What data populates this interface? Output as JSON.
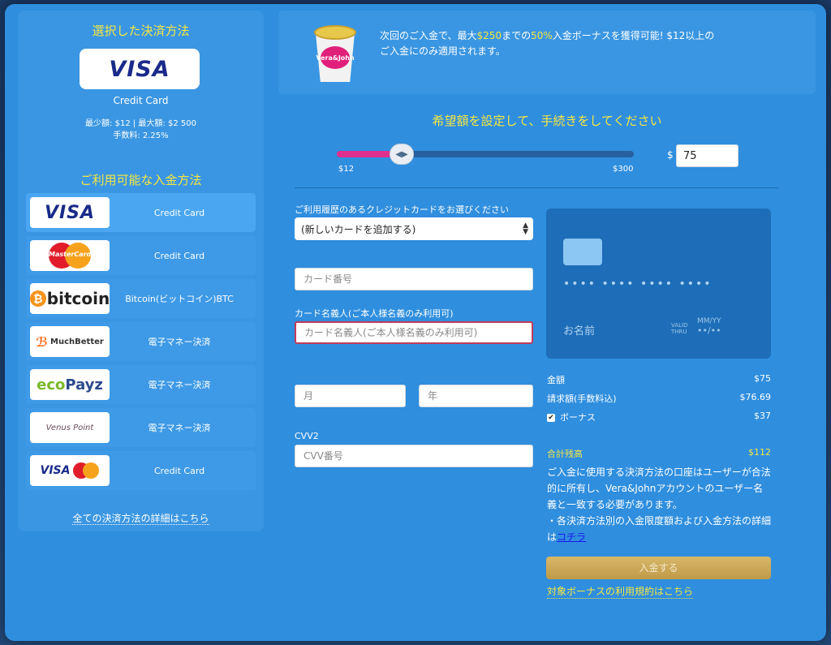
{
  "close": "×",
  "selected": {
    "title": "選択した決済方法",
    "logo": "VISA",
    "name": "Credit Card",
    "limits": "最少額: $12 | 最大額: $2 500",
    "fee": "手数料: 2.25%"
  },
  "available": {
    "title": "ご利用可能な入金方法",
    "methods": [
      {
        "logo": "VISA",
        "label": "Credit Card",
        "active": true
      },
      {
        "logo": "MasterCard",
        "label": "Credit Card"
      },
      {
        "logo": "bitcoin",
        "label": "Bitcoin(ビットコイン)BTC"
      },
      {
        "logo": "MuchBetter",
        "label": "電子マネー決済"
      },
      {
        "logo": "ecoPayz",
        "label": "電子マネー決済"
      },
      {
        "logo": "Venus Point",
        "label": "電子マネー決済"
      },
      {
        "logo": "VISA",
        "label": "Credit Card"
      }
    ],
    "all_link": "全ての決済方法の詳細はこちら"
  },
  "promo": {
    "cup_brand": "Vera&John",
    "line1_a": "次回のご入金で、最大",
    "line1_b": "$250",
    "line1_c": "までの",
    "line1_d": "50%",
    "line1_e": "入金ボーナスを獲得可能! $12以上の",
    "line2": "ご入金にのみ適用されます。"
  },
  "amount": {
    "title": "希望額を設定して、手続きをしてください",
    "min_label": "$12",
    "max_label": "$300",
    "min": 12,
    "max": 300,
    "value": 75,
    "currency": "$",
    "input_value": "75"
  },
  "form": {
    "saved_card_label": "ご利用履歴のあるクレジットカードをお選びください",
    "saved_card_value": "(新しいカードを追加する)",
    "card_number_placeholder": "カード番号",
    "holder_label": "カード名義人(ご本人様名義のみ利用可)",
    "holder_placeholder": "カード名義人(ご本人様名義のみ利用可)",
    "month_placeholder": "月",
    "year_placeholder": "年",
    "cvv_label": "CVV2",
    "cvv_placeholder": "CVV番号"
  },
  "card_preview": {
    "number": "•••• •••• •••• ••••",
    "name": "お名前",
    "valid": "VALID",
    "thru": "THRU",
    "mmyy": "MM/YY",
    "expiry": "••/••"
  },
  "summary": {
    "amount_label": "金額",
    "amount_value": "$75",
    "billed_label": "請求額(手数料込)",
    "billed_value": "$76.69",
    "bonus_label": "ボーナス",
    "bonus_value": "$37",
    "bonus_checked": "✔",
    "total_label": "合計残高",
    "total_value": "$112"
  },
  "notice": {
    "text1": "ご入金に使用する決済方法の口座はユーザーが合法的に所有し、Vera&Johnアカウントのユーザー名義と一致する必要があります。",
    "text2": "・各決済方法別の入金限度額および入金方法の詳細は",
    "link": "コチラ"
  },
  "deposit_button": "入金する",
  "terms_link": "対象ボーナスの利用規約はこちら",
  "colors": {
    "modal_bg": "#2f8ede",
    "accent_yellow": "#f5e642",
    "slider_fill": "#e0308e",
    "button_gold": "#c9a450"
  }
}
